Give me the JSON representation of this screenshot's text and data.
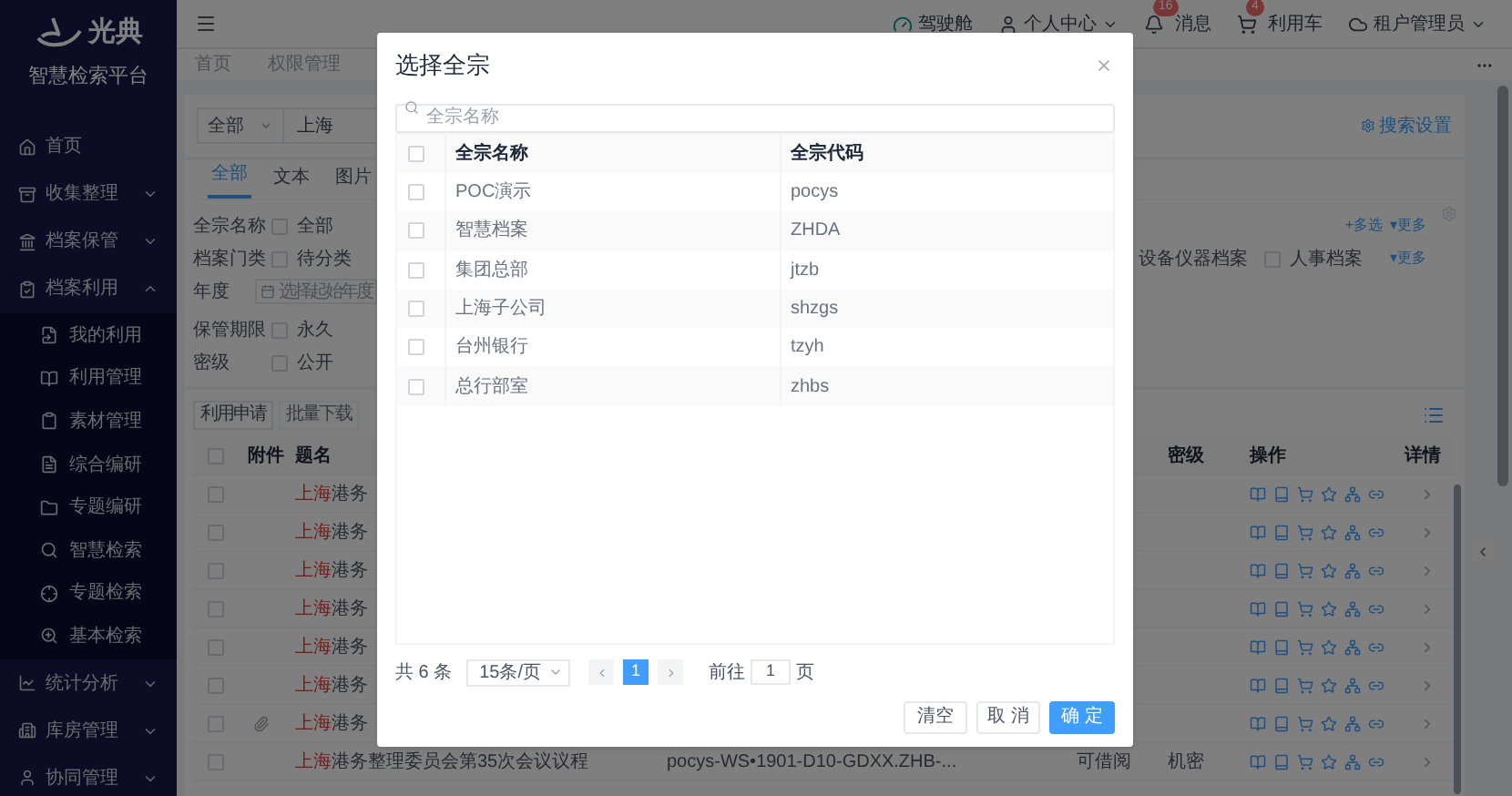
{
  "sidebar": {
    "logo": "光典",
    "subtitle": "智慧检索平台",
    "items": [
      {
        "label": "首页"
      },
      {
        "label": "收集整理",
        "expanded": false
      },
      {
        "label": "档案保管",
        "expanded": false
      },
      {
        "label": "档案利用",
        "expanded": true,
        "children": [
          {
            "label": "我的利用"
          },
          {
            "label": "利用管理"
          },
          {
            "label": "素材管理"
          },
          {
            "label": "综合编研"
          },
          {
            "label": "专题编研"
          },
          {
            "label": "智慧检索"
          },
          {
            "label": "专题检索"
          },
          {
            "label": "基本检索"
          }
        ]
      },
      {
        "label": "统计分析",
        "expanded": false
      },
      {
        "label": "库房管理",
        "expanded": false
      },
      {
        "label": "协同管理",
        "expanded": false
      }
    ]
  },
  "header": {
    "items": [
      {
        "label": "驾驶舱"
      },
      {
        "label": "个人中心",
        "dropdown": true
      },
      {
        "label": "消息",
        "badge": "16"
      },
      {
        "label": "利用车",
        "badge": "4"
      },
      {
        "label": "租户管理员",
        "dropdown": true
      }
    ]
  },
  "page_tabs": [
    "首页",
    "权限管理"
  ],
  "search": {
    "scope": "全部",
    "query": "上海",
    "settings": "搜索设置"
  },
  "content_tabs": [
    {
      "label": "全部",
      "selected": true
    },
    {
      "label": "文本",
      "selected": false
    },
    {
      "label": "图片",
      "selected": false
    }
  ],
  "filters": [
    {
      "label": "全宗名称",
      "options": [
        {
          "label": "全部",
          "checked": false
        }
      ],
      "right": {
        "links": [
          "+多选",
          "▾更多"
        ]
      }
    },
    {
      "label": "档案门类",
      "options": [
        {
          "label": "待分类",
          "checked": false
        }
      ],
      "right": {
        "options": [
          {
            "label": "设备仪器档案"
          },
          {
            "label": "人事档案",
            "checked": false
          }
        ],
        "links": [
          "▾更多"
        ]
      }
    },
    {
      "label": "年度",
      "date_placeholder": "选择起始年度"
    },
    {
      "label": "保管期限",
      "options": [
        {
          "label": "永久",
          "checked": false
        }
      ]
    },
    {
      "label": "密级",
      "options": [
        {
          "label": "公开",
          "checked": false
        }
      ]
    }
  ],
  "actions": [
    {
      "label": "利用申请",
      "disabled": false
    },
    {
      "label": "批量下载",
      "disabled": true
    }
  ],
  "table": {
    "select_all": false,
    "columns": {
      "attachment": "附件",
      "title": "题名",
      "secrecy": "密级",
      "operations": "操作",
      "details": "详情"
    },
    "rows": [
      {
        "checked": false,
        "attachment": false,
        "title_hit": "上海",
        "title_rest": "港务"
      },
      {
        "checked": false,
        "attachment": false,
        "title_hit": "上海",
        "title_rest": "港务"
      },
      {
        "checked": false,
        "attachment": false,
        "title_hit": "上海",
        "title_rest": "港务"
      },
      {
        "checked": false,
        "attachment": false,
        "title_hit": "上海",
        "title_rest": "港务"
      },
      {
        "checked": false,
        "attachment": false,
        "title_hit": "上海",
        "title_rest": "港务"
      },
      {
        "checked": false,
        "attachment": false,
        "title_hit": "上海",
        "title_rest": "港务"
      },
      {
        "checked": false,
        "attachment": true,
        "title_hit": "上海",
        "title_rest": "港务"
      },
      {
        "checked": false,
        "attachment": false,
        "title_hit": "上海",
        "title_rest": "港务整理委员会第35次会议议程",
        "code": "pocys-WS•1901-D10-GDXX.ZHB-...",
        "status": "可借阅",
        "secrecy": "机密"
      }
    ]
  },
  "dialog": {
    "title": "选择全宗",
    "search_placeholder": "全宗名称",
    "select_all": false,
    "columns": [
      "全宗名称",
      "全宗代码"
    ],
    "rows": [
      {
        "name": "POC演示",
        "code": "pocys",
        "checked": false
      },
      {
        "name": "智慧档案",
        "code": "ZHDA",
        "checked": false
      },
      {
        "name": "集团总部",
        "code": "jtzb",
        "checked": false
      },
      {
        "name": "上海子公司",
        "code": "shzgs",
        "checked": false
      },
      {
        "name": "台州银行",
        "code": "tzyh",
        "checked": false
      },
      {
        "name": "总行部室",
        "code": "zhbs",
        "checked": false
      }
    ],
    "pagination": {
      "total": "共 6 条",
      "page_size": "15条/页",
      "pages": [
        {
          "label": "1",
          "selected": true
        }
      ],
      "goto_label": "前往",
      "goto_value": "1",
      "page_suffix": "页"
    },
    "buttons": [
      {
        "label": "清空",
        "kind": "default"
      },
      {
        "label": "取 消",
        "kind": "default"
      },
      {
        "label": "确 定",
        "kind": "primary"
      }
    ]
  }
}
